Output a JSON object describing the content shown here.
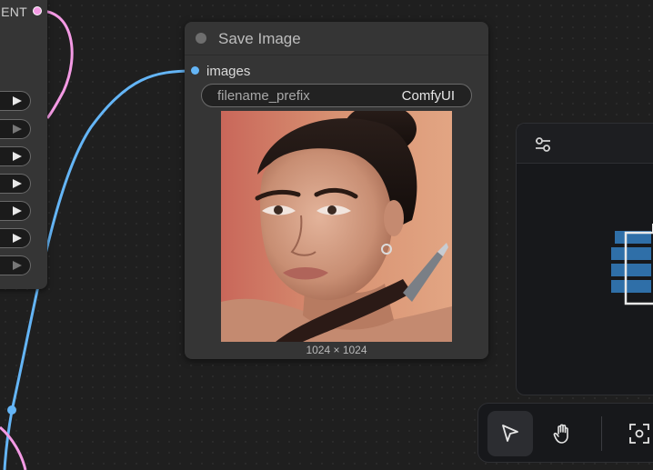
{
  "left_node": {
    "output_label": "ENT",
    "output_color": "#f49ae4"
  },
  "save_node": {
    "title": "Save Image",
    "input_label": "images",
    "input_color": "#64b5f6",
    "widget": {
      "label": "filename_prefix",
      "value": "ComfyUI"
    },
    "preview_alt": "generated portrait image",
    "image_size": "1024 × 1024"
  },
  "right_panel": {
    "settings_icon": "sliders-icon"
  },
  "toolbar": {
    "select_icon": "pointer-icon",
    "pan_icon": "hand-icon",
    "fit_icon": "focus-frame-icon"
  }
}
